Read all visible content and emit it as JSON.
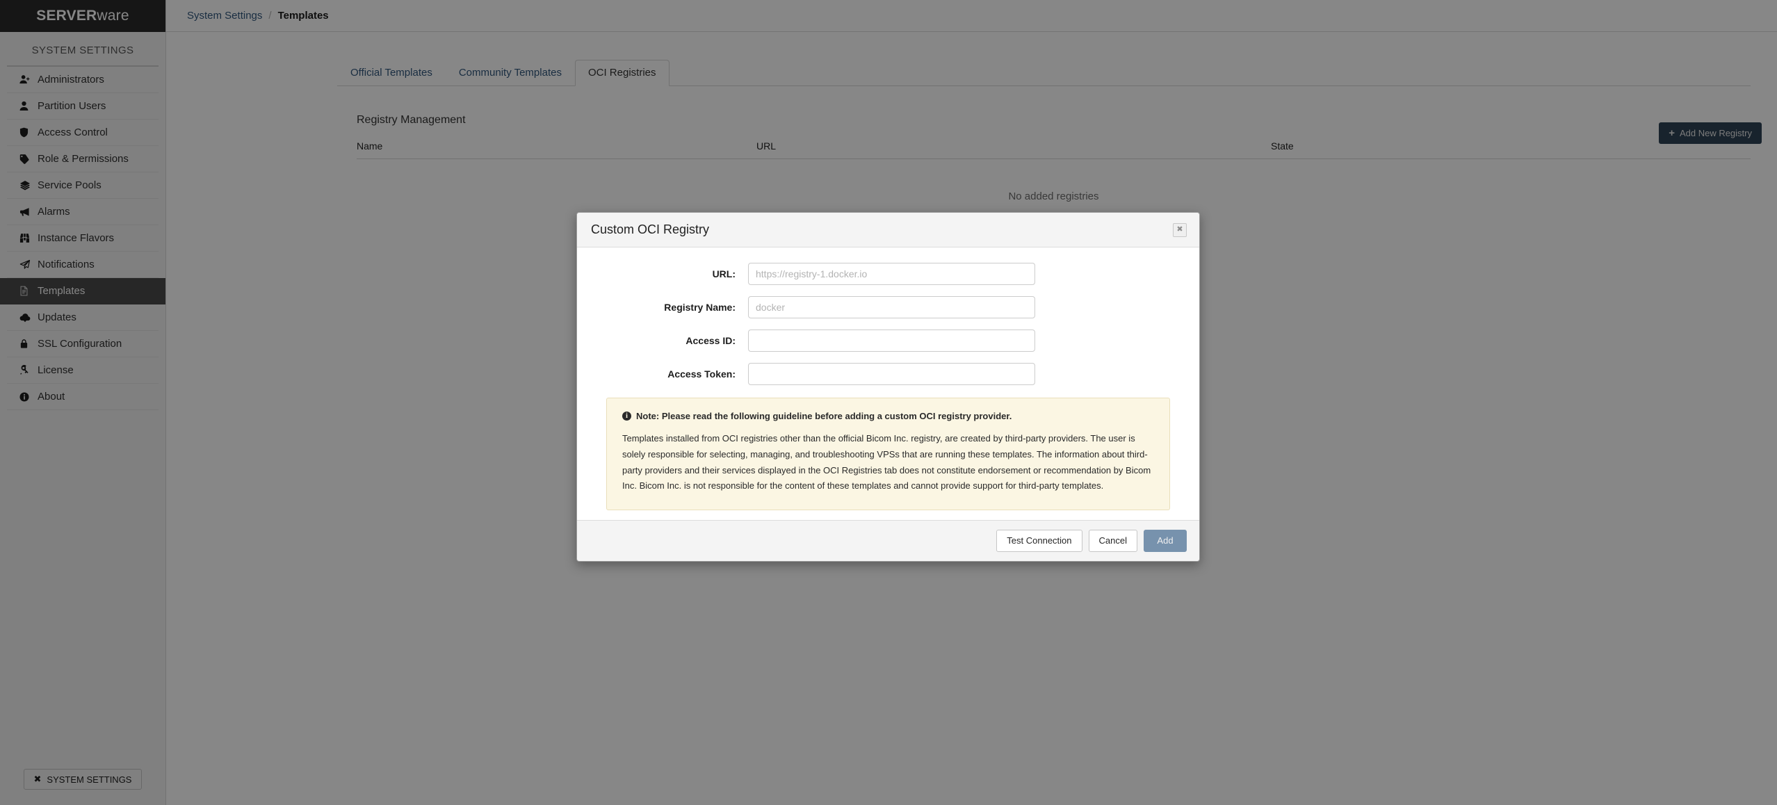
{
  "brand": {
    "strong": "SERVER",
    "light": "ware"
  },
  "sidebar": {
    "title": "SYSTEM SETTINGS",
    "items": [
      {
        "label": "Administrators",
        "icon": "user-plus-icon"
      },
      {
        "label": "Partition Users",
        "icon": "user-icon"
      },
      {
        "label": "Access Control",
        "icon": "shield-icon"
      },
      {
        "label": "Role & Permissions",
        "icon": "tags-icon"
      },
      {
        "label": "Service Pools",
        "icon": "layers-icon"
      },
      {
        "label": "Alarms",
        "icon": "bullhorn-icon"
      },
      {
        "label": "Instance Flavors",
        "icon": "binoculars-icon"
      },
      {
        "label": "Notifications",
        "icon": "paper-plane-icon"
      },
      {
        "label": "Templates",
        "icon": "file-text-icon",
        "active": true
      },
      {
        "label": "Updates",
        "icon": "cloud-download-icon"
      },
      {
        "label": "SSL Configuration",
        "icon": "lock-icon"
      },
      {
        "label": "License",
        "icon": "key-icon"
      },
      {
        "label": "About",
        "icon": "info-circle-icon"
      }
    ],
    "footer_button": "SYSTEM SETTINGS"
  },
  "breadcrumb": {
    "parent": "System Settings",
    "separator": "/",
    "current": "Templates"
  },
  "tabs": [
    {
      "label": "Official Templates",
      "active": false
    },
    {
      "label": "Community Templates",
      "active": false
    },
    {
      "label": "OCI Registries",
      "active": true
    }
  ],
  "main": {
    "section_title": "Registry Management",
    "add_button": "Add New Registry",
    "add_button_icon": "plus-icon",
    "table": {
      "columns": [
        "Name",
        "URL",
        "State"
      ],
      "rows": [],
      "empty_text": "No added registries"
    }
  },
  "modal": {
    "title": "Custom OCI Registry",
    "close_icon": "close-icon",
    "fields": [
      {
        "label": "URL:",
        "value": "",
        "placeholder": "https://registry-1.docker.io",
        "name": "url-field"
      },
      {
        "label": "Registry Name:",
        "value": "",
        "placeholder": "docker",
        "name": "registry-name-field"
      },
      {
        "label": "Access ID:",
        "value": "",
        "placeholder": "",
        "name": "access-id-field"
      },
      {
        "label": "Access Token:",
        "value": "",
        "placeholder": "",
        "name": "access-token-field"
      }
    ],
    "note": {
      "icon": "info-icon",
      "heading": "Note: Please read the following guideline before adding a custom OCI registry provider.",
      "body": "Templates installed from OCI registries other than the official Bicom Inc. registry, are created by third-party providers. The user is solely responsible for selecting, managing, and troubleshooting VPSs that are running these templates. The information about third-party providers and their services displayed in the OCI Registries tab does not constitute endorsement or recommendation by Bicom Inc. Bicom Inc. is not responsible for the content of these templates and cannot provide support for third-party templates."
    },
    "buttons": {
      "test": "Test Connection",
      "cancel": "Cancel",
      "add": "Add"
    }
  },
  "colors": {
    "brand_bar": "#2b2b2b",
    "accent_link": "#31577d",
    "primary_button": "#7792ad",
    "dark_button": "#2e4256",
    "note_bg": "#fbf6e3"
  }
}
